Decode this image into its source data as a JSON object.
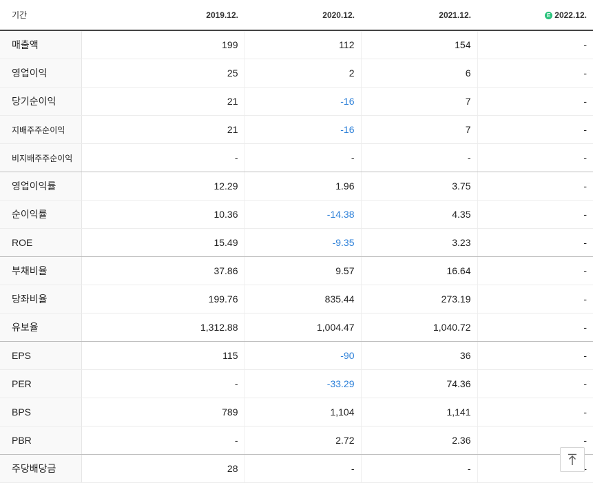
{
  "header": {
    "period_label": "기간",
    "columns": [
      "2019.12.",
      "2020.12.",
      "2021.12.",
      "2022.12."
    ],
    "estimate_icon": "E"
  },
  "rows": [
    {
      "label": "매출액",
      "values": [
        "199",
        "112",
        "154",
        "-"
      ]
    },
    {
      "label": "영업이익",
      "values": [
        "25",
        "2",
        "6",
        "-"
      ]
    },
    {
      "label": "당기순이익",
      "values": [
        "21",
        "-16",
        "7",
        "-"
      ]
    },
    {
      "label": "지배주주순이익",
      "values": [
        "21",
        "-16",
        "7",
        "-"
      ]
    },
    {
      "label": "비지배주주순이익",
      "values": [
        "-",
        "-",
        "-",
        "-"
      ]
    },
    {
      "label": "영업이익률",
      "values": [
        "12.29",
        "1.96",
        "3.75",
        "-"
      ]
    },
    {
      "label": "순이익률",
      "values": [
        "10.36",
        "-14.38",
        "4.35",
        "-"
      ]
    },
    {
      "label": "ROE",
      "values": [
        "15.49",
        "-9.35",
        "3.23",
        "-"
      ]
    },
    {
      "label": "부채비율",
      "values": [
        "37.86",
        "9.57",
        "16.64",
        "-"
      ]
    },
    {
      "label": "당좌비율",
      "values": [
        "199.76",
        "835.44",
        "273.19",
        "-"
      ]
    },
    {
      "label": "유보율",
      "values": [
        "1,312.88",
        "1,004.47",
        "1,040.72",
        "-"
      ]
    },
    {
      "label": "EPS",
      "values": [
        "115",
        "-90",
        "36",
        "-"
      ]
    },
    {
      "label": "PER",
      "values": [
        "-",
        "-33.29",
        "74.36",
        "-"
      ]
    },
    {
      "label": "BPS",
      "values": [
        "789",
        "1,104",
        "1,141",
        "-"
      ]
    },
    {
      "label": "PBR",
      "values": [
        "-",
        "2.72",
        "2.36",
        "-"
      ]
    },
    {
      "label": "주당배당금",
      "values": [
        "28",
        "-",
        "-",
        "-"
      ]
    }
  ],
  "colors": {
    "negative": "#2b7fd8",
    "estimate_badge": "#27c27a"
  },
  "scroll_top_icon": "arrow-up-to-top-icon"
}
